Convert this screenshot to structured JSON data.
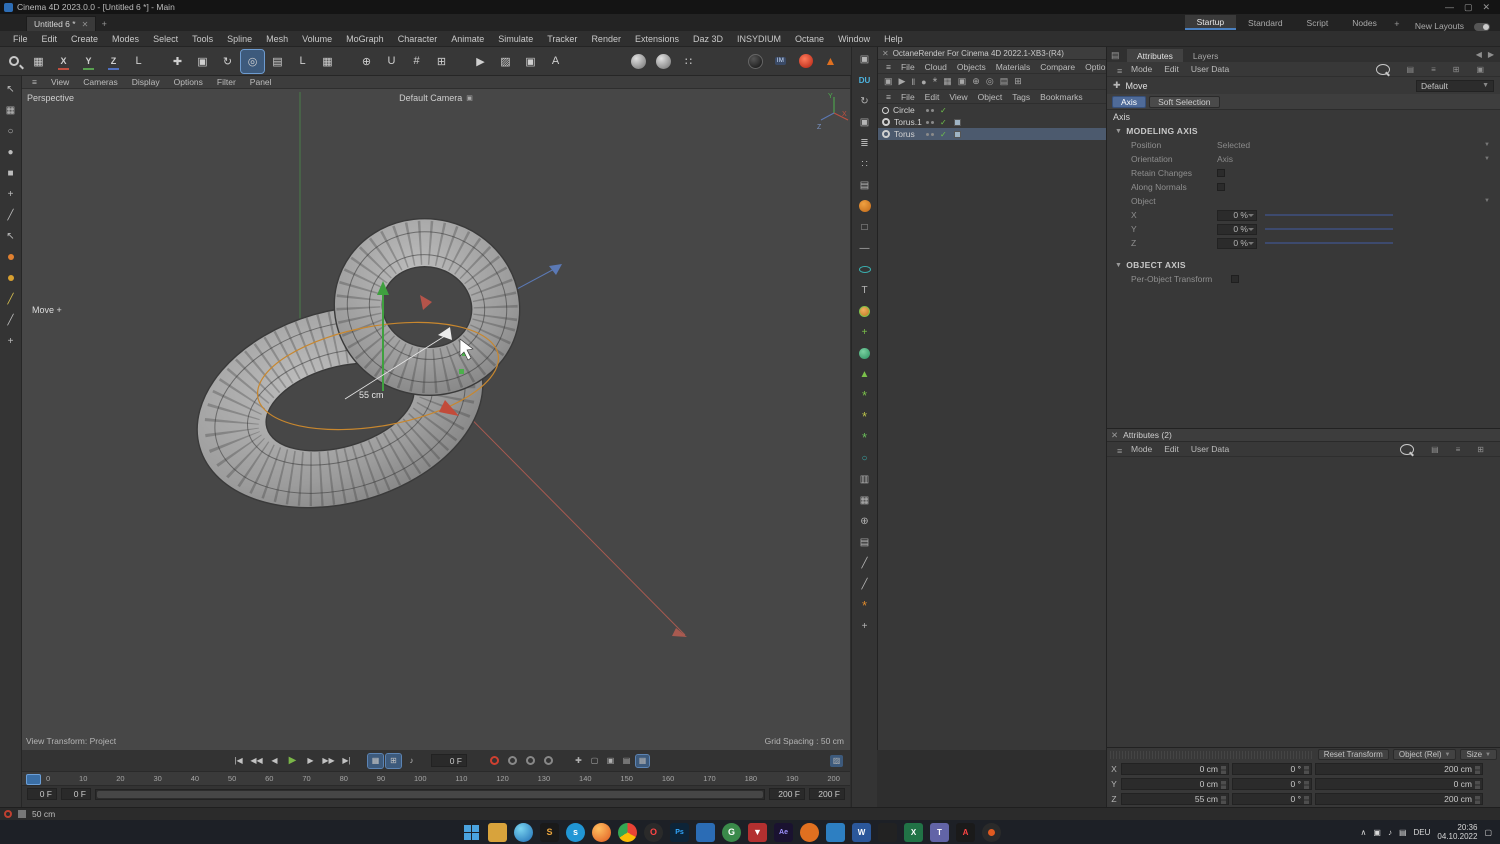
{
  "title_bar": {
    "title": "Cinema 4D 2023.0.0 - [Untitled 6 *] - Main"
  },
  "tab_bar": {
    "document_tab": "Untitled 6 *",
    "layout_tabs": [
      "Startup",
      "Standard",
      "Script",
      "Nodes"
    ],
    "new_layouts": "New Layouts"
  },
  "menu_bar": {
    "items": [
      "File",
      "Edit",
      "Create",
      "Modes",
      "Select",
      "Tools",
      "Spline",
      "Mesh",
      "Volume",
      "MoGraph",
      "Character",
      "Animate",
      "Simulate",
      "Tracker",
      "Render",
      "Extensions",
      "Daz 3D",
      "INSYDIUM",
      "Octane",
      "Window",
      "Help"
    ]
  },
  "viewport": {
    "menu": [
      "View",
      "Cameras",
      "Display",
      "Options",
      "Filter",
      "Panel"
    ],
    "perspective_label": "Perspective",
    "camera_label": "Default Camera",
    "tool_hint": "Move",
    "measurement": "55 cm",
    "status_left": "View Transform: Project",
    "status_right": "Grid Spacing : 50 cm",
    "axis": {
      "x": "X",
      "y": "Y",
      "z": "Z"
    }
  },
  "octane_panel": {
    "title": "OctaneRender For Cinema 4D 2022.1-XB3-(R4)",
    "menu": [
      "File",
      "Cloud",
      "Objects",
      "Materials",
      "Compare",
      "Options"
    ]
  },
  "object_manager": {
    "menu": [
      "File",
      "Edit",
      "View",
      "Object",
      "Tags",
      "Bookmarks"
    ],
    "objects": [
      {
        "name": "Circle"
      },
      {
        "name": "Torus.1"
      },
      {
        "name": "Torus"
      }
    ]
  },
  "attributes_panel": {
    "tabs": [
      "Attributes",
      "Layers"
    ],
    "menu": [
      "Mode",
      "Edit",
      "User Data"
    ],
    "tool_label": "Move",
    "preset_value": "Default",
    "mode_buttons": [
      "Axis",
      "Soft Selection"
    ],
    "subtitle": "Axis",
    "modeling_axis": {
      "header": "MODELING AXIS",
      "rows": {
        "position": {
          "label": "Position",
          "value": "Selected"
        },
        "orientation": {
          "label": "Orientation",
          "value": "Axis"
        },
        "retain": {
          "label": "Retain Changes"
        },
        "along": {
          "label": "Along Normals"
        },
        "object": {
          "label": "Object"
        },
        "x": {
          "label": "X",
          "value": "0 %"
        },
        "y": {
          "label": "Y",
          "value": "0 %"
        },
        "z": {
          "label": "Z",
          "value": "0 %"
        }
      }
    },
    "object_axis": {
      "header": "OBJECT AXIS",
      "per_object_label": "Per-Object Transform"
    }
  },
  "attributes_panel_2": {
    "title": "Attributes (2)",
    "menu": [
      "Mode",
      "Edit",
      "User Data"
    ]
  },
  "coordinates_panel": {
    "buttons": {
      "reset": "Reset Transform",
      "object": "Object (Rel)",
      "size": "Size"
    },
    "rows": [
      {
        "axis": "X",
        "position": "0 cm",
        "rotation": "0 °",
        "size": "200 cm"
      },
      {
        "axis": "Y",
        "position": "0 cm",
        "rotation": "0 °",
        "size": "0 cm"
      },
      {
        "axis": "Z",
        "position": "55 cm",
        "rotation": "0 °",
        "size": "200 cm"
      }
    ]
  },
  "timeline": {
    "current_frame": "0 F",
    "ticks": [
      "0",
      "10",
      "20",
      "30",
      "40",
      "50",
      "60",
      "70",
      "80",
      "90",
      "100",
      "110",
      "120",
      "130",
      "140",
      "150",
      "160",
      "170",
      "180",
      "190",
      "200"
    ],
    "range": {
      "start_a": "0 F",
      "start_b": "0 F",
      "end_a": "200 F",
      "end_b": "200 F"
    }
  },
  "status_bar": {
    "measurement": "50 cm"
  },
  "taskbar": {
    "language": "DEU",
    "time": "20:36",
    "date": "04.10.2022"
  }
}
